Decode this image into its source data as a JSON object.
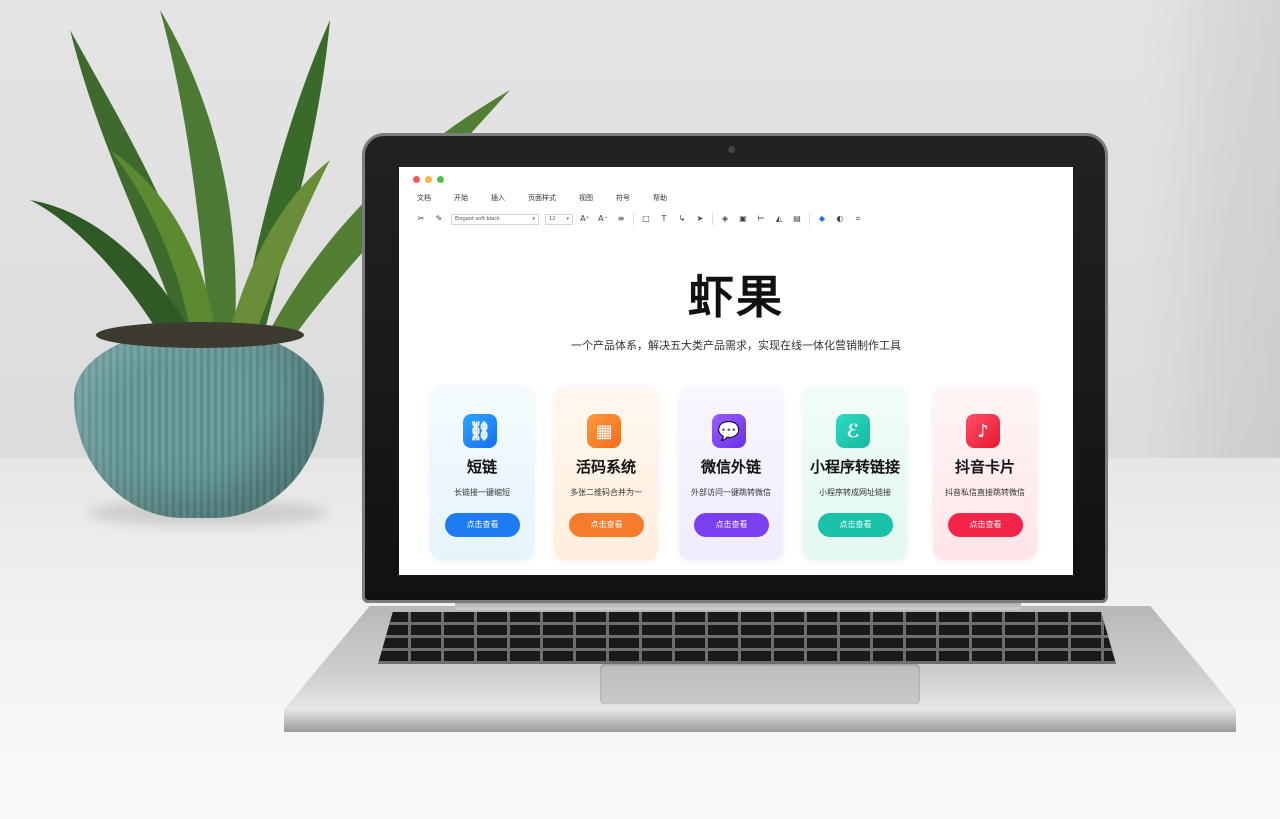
{
  "window": {
    "controls": [
      "close",
      "minimize",
      "maximize"
    ]
  },
  "menu": [
    "文档",
    "开始",
    "插入",
    "页面样式",
    "视图",
    "符号",
    "帮助"
  ],
  "toolbar": {
    "font_family": "Elegant soft black",
    "font_size": "12",
    "icons": [
      "scissors-icon",
      "brush-icon",
      "font-increase-icon",
      "font-decrease-icon",
      "align-icon",
      "rectangle-icon",
      "text-icon",
      "connector-icon",
      "pointer-icon",
      "layers-icon",
      "group-icon",
      "align-left-icon",
      "flip-icon",
      "image-icon",
      "fill-color-icon",
      "shape-icon",
      "crop-icon"
    ]
  },
  "hero": {
    "title": "虾果",
    "subtitle": "一个产品体系，解决五大类产品需求，实现在线一体化营销制作工具"
  },
  "cards": [
    {
      "title": "短链",
      "desc": "长链接一键缩短",
      "button": "点击查看",
      "icon": "link-icon",
      "accent": "#1e7cf2"
    },
    {
      "title": "活码系统",
      "desc": "多张二维码合并为一",
      "button": "点击查看",
      "icon": "qrcode-icon",
      "accent": "#f57c2a"
    },
    {
      "title": "微信外链",
      "desc": "外部访问一键跳转微信",
      "button": "点击查看",
      "icon": "wechat-icon",
      "accent": "#7a3ff0"
    },
    {
      "title": "小程序转链接",
      "desc": "小程序转成网址链接",
      "button": "点击查看",
      "icon": "miniprogram-icon",
      "accent": "#19c2a8"
    },
    {
      "title": "抖音卡片",
      "desc": "抖音私信直接跳转微信",
      "button": "点击查看",
      "icon": "douyin-icon",
      "accent": "#f5254a"
    }
  ]
}
